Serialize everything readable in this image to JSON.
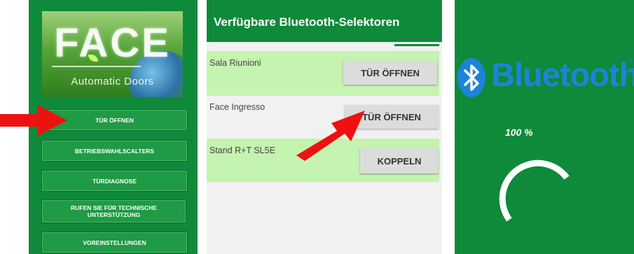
{
  "panel1": {
    "logo_title": "FACE",
    "logo_subtitle": "Automatic Doors",
    "menu": [
      "TÜR ÖFFNEN",
      "BETRIEBSWAHLSCALTERS",
      "TÜRDIAGNOSE",
      "RUFEN SIE FÜR TECHNISCHE UNTERSTÜTZUNG",
      "VOREINSTELLUNGEN"
    ]
  },
  "panel2": {
    "title": "Verfügbare Bluetooth-Selektoren",
    "devices": [
      {
        "name": "Sala Riunioni",
        "button": "TÜR ÖFFNEN",
        "highlighted": true
      },
      {
        "name": "Face Ingresso",
        "button": "TÜR ÖFFNEN",
        "highlighted": false
      },
      {
        "name": "Stand R+T SL5E",
        "button": "KOPPELN",
        "highlighted": true
      }
    ]
  },
  "panel3": {
    "brand": "Bluetooth",
    "registered": "®",
    "progress_text": "100 %",
    "progress": 1.0
  },
  "colors": {
    "app_green": "#0e8a3a",
    "button_green": "#1f9a45",
    "highlight_row": "#c5f3b0",
    "bluetooth_blue": "#1c84d8",
    "arrow_red": "#ee1111"
  },
  "icons": [
    "bluetooth-icon",
    "red-arrow-indicator",
    "loading-spinner"
  ]
}
